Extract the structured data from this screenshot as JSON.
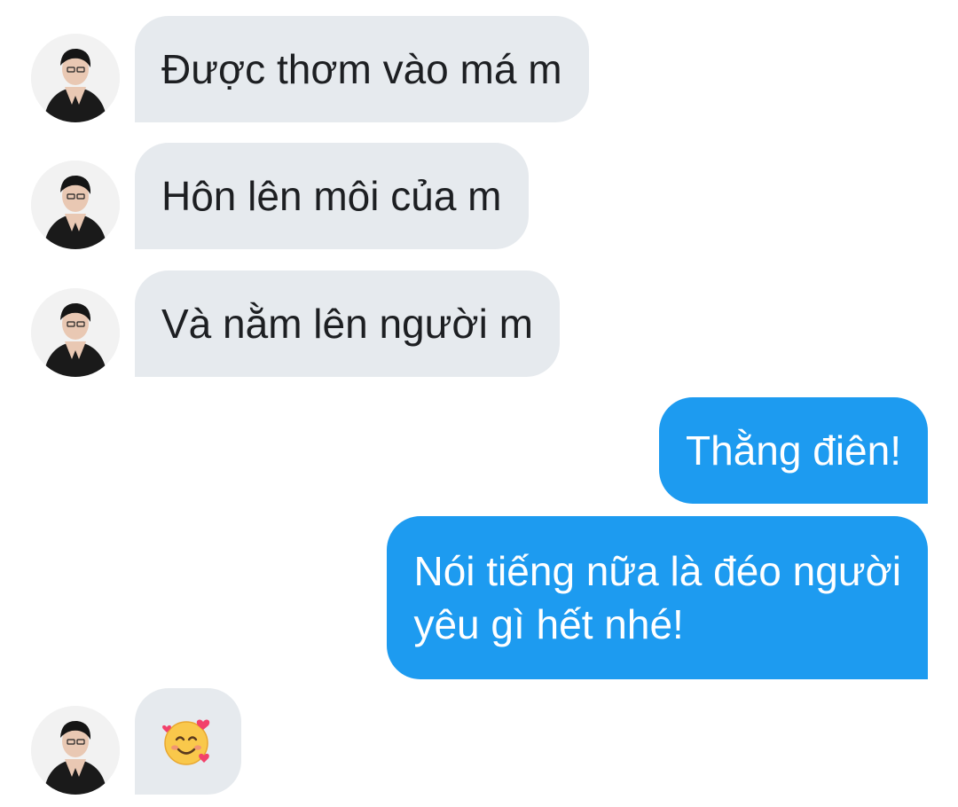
{
  "conversation": {
    "messages": [
      {
        "side": "incoming",
        "text": "Được thơm vào má m"
      },
      {
        "side": "incoming",
        "text": "Hôn lên môi của m"
      },
      {
        "side": "incoming",
        "text": "Và nằm lên người m"
      },
      {
        "side": "outgoing",
        "text": "Thằng điên!"
      },
      {
        "side": "outgoing",
        "lines": [
          "Nói tiếng nữa là đéo người",
          "yêu gì hết nhé!"
        ]
      },
      {
        "side": "incoming",
        "emoji": "smiling-face-with-hearts-icon"
      }
    ]
  },
  "colors": {
    "incoming_bubble": "#e6eaee",
    "outgoing_bubble": "#1d9bf0",
    "incoming_text": "#1d1f22",
    "outgoing_text": "#ffffff"
  }
}
